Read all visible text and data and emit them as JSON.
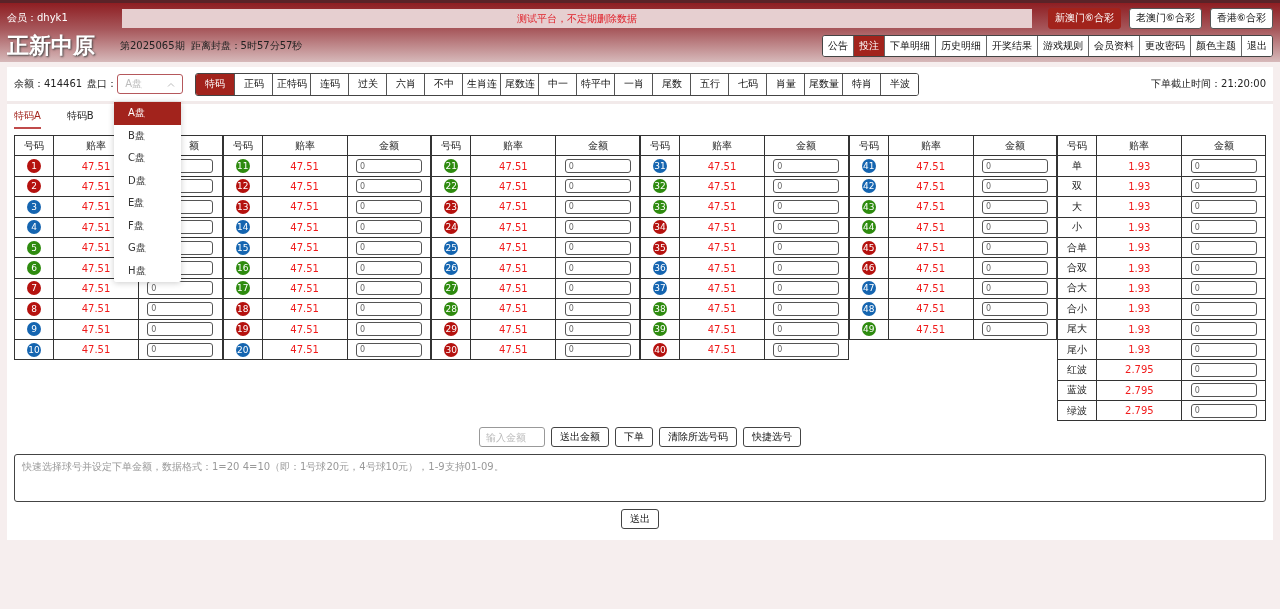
{
  "header": {
    "member": "会员：dhyk1",
    "notice": "测试平台，不定期删除数据",
    "lotteries": [
      {
        "label": "新澳门⑥合彩",
        "selected": true
      },
      {
        "label": "老澳门⑥合彩",
        "selected": false
      },
      {
        "label": "香港⑥合彩",
        "selected": false
      }
    ],
    "site_title": "正新中原",
    "issue": "第2025065期",
    "countdown": "距离封盘：5时57分57秒",
    "nav": [
      {
        "label": "公告",
        "selected": false
      },
      {
        "label": "投注",
        "selected": true
      },
      {
        "label": "下单明细",
        "selected": false
      },
      {
        "label": "历史明细",
        "selected": false
      },
      {
        "label": "开奖结果",
        "selected": false
      },
      {
        "label": "游戏规则",
        "selected": false
      },
      {
        "label": "会员资料",
        "selected": false
      },
      {
        "label": "更改密码",
        "selected": false
      },
      {
        "label": "颜色主题",
        "selected": false
      },
      {
        "label": "退出",
        "selected": false
      }
    ]
  },
  "toolbar": {
    "balance": "余额：414461",
    "plate_label": "盘口：",
    "plate_value": "A盘",
    "games": [
      {
        "label": "特码",
        "selected": true
      },
      {
        "label": "正码",
        "selected": false
      },
      {
        "label": "正特码",
        "selected": false
      },
      {
        "label": "连码",
        "selected": false
      },
      {
        "label": "过关",
        "selected": false
      },
      {
        "label": "六肖",
        "selected": false
      },
      {
        "label": "不中",
        "selected": false
      },
      {
        "label": "生肖连",
        "selected": false
      },
      {
        "label": "尾数连",
        "selected": false
      },
      {
        "label": "中一",
        "selected": false
      },
      {
        "label": "特平中",
        "selected": false
      },
      {
        "label": "一肖",
        "selected": false
      },
      {
        "label": "尾数",
        "selected": false
      },
      {
        "label": "五行",
        "selected": false
      },
      {
        "label": "七码",
        "selected": false
      },
      {
        "label": "肖量",
        "selected": false
      },
      {
        "label": "尾数量",
        "selected": false
      },
      {
        "label": "特肖",
        "selected": false
      },
      {
        "label": "半波",
        "selected": false
      }
    ],
    "deadline": "下单截止时间：21:20:00"
  },
  "plate_menu": [
    {
      "label": "A盘",
      "selected": true
    },
    {
      "label": "B盘",
      "selected": false
    },
    {
      "label": "C盘",
      "selected": false
    },
    {
      "label": "D盘",
      "selected": false
    },
    {
      "label": "E盘",
      "selected": false
    },
    {
      "label": "F盘",
      "selected": false
    },
    {
      "label": "G盘",
      "selected": false
    },
    {
      "label": "H盘",
      "selected": false
    }
  ],
  "subtabs": [
    {
      "label": "特码A",
      "selected": true
    },
    {
      "label": "特码B",
      "selected": false
    }
  ],
  "groups": [
    {
      "columns": [
        "号码",
        "赔率",
        "额"
      ],
      "rows": [
        {
          "kind": "ball",
          "number": "1",
          "color": "#b5120f",
          "odds": "47.51"
        },
        {
          "kind": "ball",
          "number": "2",
          "color": "#b5120f",
          "odds": "47.51"
        },
        {
          "kind": "ball",
          "number": "3",
          "color": "#1565b0",
          "odds": "47.51"
        },
        {
          "kind": "ball",
          "number": "4",
          "color": "#1565b0",
          "odds": "47.51"
        },
        {
          "kind": "ball",
          "number": "5",
          "color": "#2e8b0f",
          "odds": "47.51"
        },
        {
          "kind": "ball",
          "number": "6",
          "color": "#2e8b0f",
          "odds": "47.51"
        },
        {
          "kind": "ball",
          "number": "7",
          "color": "#b5120f",
          "odds": "47.51",
          "amount": "0"
        },
        {
          "kind": "ball",
          "number": "8",
          "color": "#b5120f",
          "odds": "47.51",
          "amount": "0"
        },
        {
          "kind": "ball",
          "number": "9",
          "color": "#1565b0",
          "odds": "47.51",
          "amount": "0"
        },
        {
          "kind": "ball",
          "number": "10",
          "color": "#1565b0",
          "odds": "47.51",
          "amount": "0"
        }
      ]
    },
    {
      "columns": [
        "号码",
        "赔率",
        "金额"
      ],
      "rows": [
        {
          "kind": "ball",
          "number": "11",
          "color": "#2e8b0f",
          "odds": "47.51",
          "amount": "0"
        },
        {
          "kind": "ball",
          "number": "12",
          "color": "#b5120f",
          "odds": "47.51",
          "amount": "0"
        },
        {
          "kind": "ball",
          "number": "13",
          "color": "#b5120f",
          "odds": "47.51",
          "amount": "0"
        },
        {
          "kind": "ball",
          "number": "14",
          "color": "#1565b0",
          "odds": "47.51",
          "amount": "0"
        },
        {
          "kind": "ball",
          "number": "15",
          "color": "#1565b0",
          "odds": "47.51",
          "amount": "0"
        },
        {
          "kind": "ball",
          "number": "16",
          "color": "#2e8b0f",
          "odds": "47.51",
          "amount": "0"
        },
        {
          "kind": "ball",
          "number": "17",
          "color": "#2e8b0f",
          "odds": "47.51",
          "amount": "0"
        },
        {
          "kind": "ball",
          "number": "18",
          "color": "#b5120f",
          "odds": "47.51",
          "amount": "0"
        },
        {
          "kind": "ball",
          "number": "19",
          "color": "#b5120f",
          "odds": "47.51",
          "amount": "0"
        },
        {
          "kind": "ball",
          "number": "20",
          "color": "#1565b0",
          "odds": "47.51",
          "amount": "0"
        }
      ]
    },
    {
      "columns": [
        "号码",
        "赔率",
        "金额"
      ],
      "rows": [
        {
          "kind": "ball",
          "number": "21",
          "color": "#2e8b0f",
          "odds": "47.51",
          "amount": "0"
        },
        {
          "kind": "ball",
          "number": "22",
          "color": "#2e8b0f",
          "odds": "47.51",
          "amount": "0"
        },
        {
          "kind": "ball",
          "number": "23",
          "color": "#b5120f",
          "odds": "47.51",
          "amount": "0"
        },
        {
          "kind": "ball",
          "number": "24",
          "color": "#b5120f",
          "odds": "47.51",
          "amount": "0"
        },
        {
          "kind": "ball",
          "number": "25",
          "color": "#1565b0",
          "odds": "47.51",
          "amount": "0"
        },
        {
          "kind": "ball",
          "number": "26",
          "color": "#1565b0",
          "odds": "47.51",
          "amount": "0"
        },
        {
          "kind": "ball",
          "number": "27",
          "color": "#2e8b0f",
          "odds": "47.51",
          "amount": "0"
        },
        {
          "kind": "ball",
          "number": "28",
          "color": "#2e8b0f",
          "odds": "47.51",
          "amount": "0"
        },
        {
          "kind": "ball",
          "number": "29",
          "color": "#b5120f",
          "odds": "47.51",
          "amount": "0"
        },
        {
          "kind": "ball",
          "number": "30",
          "color": "#b5120f",
          "odds": "47.51",
          "amount": "0"
        }
      ]
    },
    {
      "columns": [
        "号码",
        "赔率",
        "金额"
      ],
      "rows": [
        {
          "kind": "ball",
          "number": "31",
          "color": "#1565b0",
          "odds": "47.51",
          "amount": "0"
        },
        {
          "kind": "ball",
          "number": "32",
          "color": "#2e8b0f",
          "odds": "47.51",
          "amount": "0"
        },
        {
          "kind": "ball",
          "number": "33",
          "color": "#2e8b0f",
          "odds": "47.51",
          "amount": "0"
        },
        {
          "kind": "ball",
          "number": "34",
          "color": "#b5120f",
          "odds": "47.51",
          "amount": "0"
        },
        {
          "kind": "ball",
          "number": "35",
          "color": "#b5120f",
          "odds": "47.51",
          "amount": "0"
        },
        {
          "kind": "ball",
          "number": "36",
          "color": "#1565b0",
          "odds": "47.51",
          "amount": "0"
        },
        {
          "kind": "ball",
          "number": "37",
          "color": "#1565b0",
          "odds": "47.51",
          "amount": "0"
        },
        {
          "kind": "ball",
          "number": "38",
          "color": "#2e8b0f",
          "odds": "47.51",
          "amount": "0"
        },
        {
          "kind": "ball",
          "number": "39",
          "color": "#2e8b0f",
          "odds": "47.51",
          "amount": "0"
        },
        {
          "kind": "ball",
          "number": "40",
          "color": "#b5120f",
          "odds": "47.51",
          "amount": "0"
        }
      ]
    },
    {
      "columns": [
        "号码",
        "赔率",
        "金额"
      ],
      "rows": [
        {
          "kind": "ball",
          "number": "41",
          "color": "#1565b0",
          "odds": "47.51",
          "amount": "0"
        },
        {
          "kind": "ball",
          "number": "42",
          "color": "#1565b0",
          "odds": "47.51",
          "amount": "0"
        },
        {
          "kind": "ball",
          "number": "43",
          "color": "#2e8b0f",
          "odds": "47.51",
          "amount": "0"
        },
        {
          "kind": "ball",
          "number": "44",
          "color": "#2e8b0f",
          "odds": "47.51",
          "amount": "0"
        },
        {
          "kind": "ball",
          "number": "45",
          "color": "#b5120f",
          "odds": "47.51",
          "amount": "0"
        },
        {
          "kind": "ball",
          "number": "46",
          "color": "#b5120f",
          "odds": "47.51",
          "amount": "0"
        },
        {
          "kind": "ball",
          "number": "47",
          "color": "#1565b0",
          "odds": "47.51",
          "amount": "0"
        },
        {
          "kind": "ball",
          "number": "48",
          "color": "#1565b0",
          "odds": "47.51",
          "amount": "0"
        },
        {
          "kind": "ball",
          "number": "49",
          "color": "#2e8b0f",
          "odds": "47.51",
          "amount": "0"
        }
      ]
    },
    {
      "columns": [
        "号码",
        "赔率",
        "金额"
      ],
      "rows": [
        {
          "kind": "label",
          "number": "单",
          "odds": "1.93",
          "amount": "0"
        },
        {
          "kind": "label",
          "number": "双",
          "odds": "1.93",
          "amount": "0"
        },
        {
          "kind": "label",
          "number": "大",
          "odds": "1.93",
          "amount": "0"
        },
        {
          "kind": "label",
          "number": "小",
          "odds": "1.93",
          "amount": "0"
        },
        {
          "kind": "label",
          "number": "合单",
          "odds": "1.93",
          "amount": "0"
        },
        {
          "kind": "label",
          "number": "合双",
          "odds": "1.93",
          "amount": "0"
        },
        {
          "kind": "label",
          "number": "合大",
          "odds": "1.93",
          "amount": "0"
        },
        {
          "kind": "label",
          "number": "合小",
          "odds": "1.93",
          "amount": "0"
        },
        {
          "kind": "label",
          "number": "尾大",
          "odds": "1.93",
          "amount": "0"
        },
        {
          "kind": "label",
          "number": "尾小",
          "odds": "1.93",
          "amount": "0"
        },
        {
          "kind": "label",
          "number": "红波",
          "odds": "2.795",
          "amount": "0"
        },
        {
          "kind": "label",
          "number": "蓝波",
          "odds": "2.795",
          "amount": "0"
        },
        {
          "kind": "label",
          "number": "绿波",
          "odds": "2.795",
          "amount": "0"
        }
      ]
    }
  ],
  "actions": {
    "amount_placeholder": "输入金额",
    "buttons": [
      "送出金额",
      "下单",
      "清除所选号码",
      "快捷选号"
    ]
  },
  "quick_input": {
    "placeholder": "快速选择球号并设定下单金额，数据格式：1=20 4=10（即：1号球20元，4号球10元），1-9支持01-09。"
  },
  "submit": "送出"
}
